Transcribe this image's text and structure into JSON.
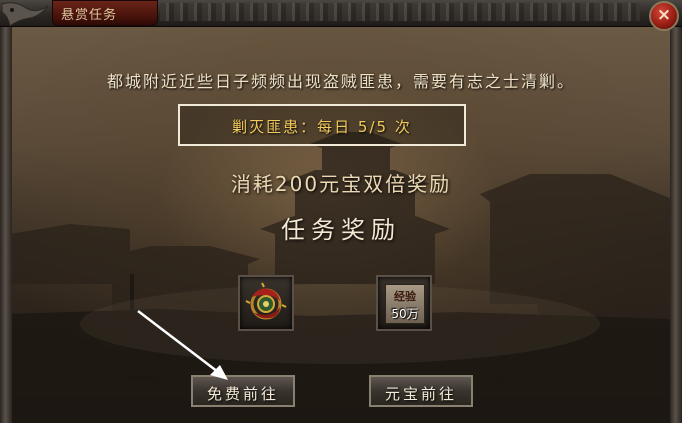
{
  "window": {
    "title": "悬赏任务",
    "close_label": "×"
  },
  "quest": {
    "description": "都城附近近些日子频频出现盗贼匪患，需要有志之士清剿。",
    "daily_limit": "剿灭匪患：每日 5/5 次",
    "double_reward_cost": "消耗200元宝双倍奖励"
  },
  "rewards": {
    "title": "任务奖励",
    "items": [
      {
        "icon": "dragon-amulet-icon"
      },
      {
        "icon": "experience-scroll-icon",
        "label": "经验",
        "quantity": "50万"
      }
    ]
  },
  "actions": {
    "free_button": "免费前往",
    "gold_button": "元宝前往"
  },
  "colors": {
    "highlight_gold": "#f2c95a",
    "title_red": "#6a2418",
    "close_red": "#9a1e14"
  }
}
